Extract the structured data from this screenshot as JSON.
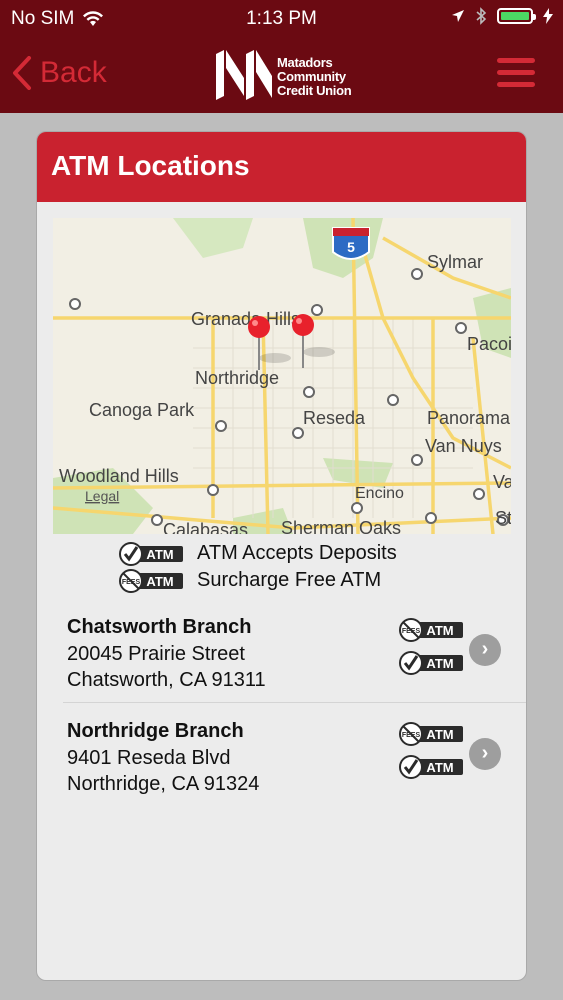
{
  "status": {
    "carrier": "No SIM",
    "time": "1:13 PM",
    "battery_color": "#4cd964"
  },
  "header": {
    "back_label": "Back",
    "logo_line1": "Matadors",
    "logo_line2": "Community",
    "logo_line3": "Credit Union",
    "menu_icon": "hamburger-icon",
    "bar_color": "#6b0a12",
    "accent_color": "#d42a36"
  },
  "card": {
    "title": "ATM Locations",
    "title_bg": "#c9222f"
  },
  "map": {
    "places": [
      "Sylmar",
      "Granada Hills",
      "Pacoima",
      "Northridge",
      "Canoga Park",
      "Reseda",
      "Panorama",
      "Van Nuys",
      "Woodland Hills",
      "Encino",
      "Calabasas",
      "Sherman Oaks",
      "Val",
      "St"
    ],
    "interstate": "5",
    "legal": "Legal"
  },
  "legend": {
    "deposit_label": "ATM Accepts Deposits",
    "surcharge_label": "Surcharge Free ATM"
  },
  "branches": [
    {
      "name": "Chatsworth Branch",
      "address": "20045 Prairie Street",
      "city": "Chatsworth, CA 91311"
    },
    {
      "name": "Northridge Branch",
      "address": "9401 Reseda Blvd",
      "city": "Northridge, CA 91324"
    }
  ],
  "icon_text": {
    "atm": "ATM",
    "fees": "FEES"
  }
}
